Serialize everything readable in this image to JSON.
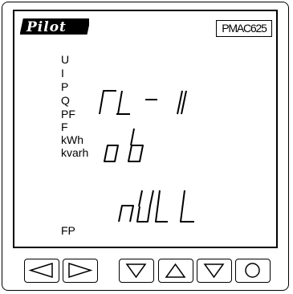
{
  "brand": {
    "logo_text": "Pilot",
    "model": "PMAC625"
  },
  "display": {
    "labels": [
      "U",
      "I",
      "P",
      "Q",
      "PF",
      "F",
      "kWh",
      "kvarh"
    ],
    "fp_label": "FP",
    "line1": "rL-1",
    "line2": "ob",
    "line3": "nULL"
  },
  "buttons": [
    {
      "name": "left-button",
      "icon": "left-arrow-icon"
    },
    {
      "name": "right-button",
      "icon": "right-arrow-icon"
    },
    {
      "name": "down-button",
      "icon": "down-arrow-icon"
    },
    {
      "name": "up-button",
      "icon": "up-arrow-icon"
    },
    {
      "name": "enter-button",
      "icon": "down-arrow-icon"
    },
    {
      "name": "circle-button",
      "icon": "circle-icon"
    }
  ]
}
